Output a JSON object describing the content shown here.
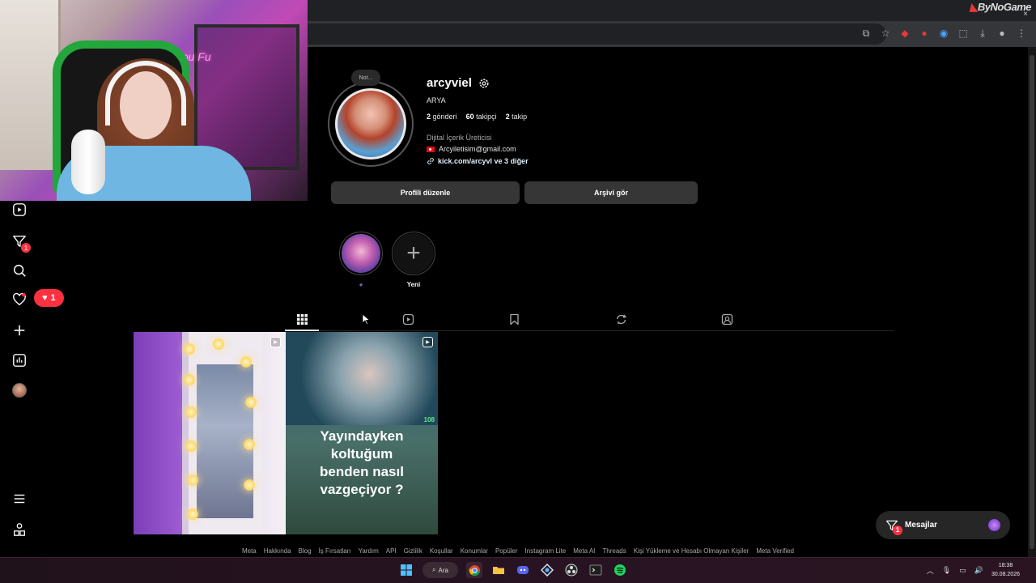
{
  "browser": {
    "brand": "ByNoGame",
    "close": "×"
  },
  "webcam": {
    "neon_sign": "Vou Fu"
  },
  "sidebar": {
    "messages_badge": "1",
    "notification_count": "1"
  },
  "profile": {
    "note": "Not...",
    "username": "arcyviel",
    "fullname": "ARYA",
    "posts_count": "2",
    "posts_label": "gönderi",
    "followers_count": "60",
    "followers_label": "takipçi",
    "following_count": "2",
    "following_label": "takip",
    "category": "Dijital İçerik Üreticisi",
    "email": "Arcyiletisim@gmail.com",
    "link": "kick.com/arcyvl ve 3 diğer",
    "edit_button": "Profili düzenle",
    "archive_button": "Arşivi gör"
  },
  "highlights": [
    {
      "label": "●"
    },
    {
      "label": "Yeni"
    }
  ],
  "posts": [
    {
      "type": "reel",
      "caption": ""
    },
    {
      "type": "reel",
      "caption_lines": [
        "Yayındayken",
        "koltuğum",
        "benden nasıl",
        "vazgeçiyor ?"
      ],
      "counter": "108"
    }
  ],
  "messages": {
    "label": "Mesajlar",
    "badge": "1"
  },
  "footer_links": [
    "Meta",
    "Hakkında",
    "Blog",
    "İş Fırsatları",
    "Yardım",
    "API",
    "Gizlilik",
    "Koşullar",
    "Konumlar",
    "Popüler",
    "Instagram Lite",
    "Meta AI",
    "Threads",
    "Kişi Yükleme ve Hesabı Olmayan Kişiler",
    "Meta Verified"
  ],
  "taskbar": {
    "search_label": "Ara",
    "time": "18:38",
    "date": "30.08.2026"
  },
  "colors": {
    "background": "#000000",
    "button": "#363636",
    "badge": "#ff3040",
    "link": "#e0f1ff"
  }
}
